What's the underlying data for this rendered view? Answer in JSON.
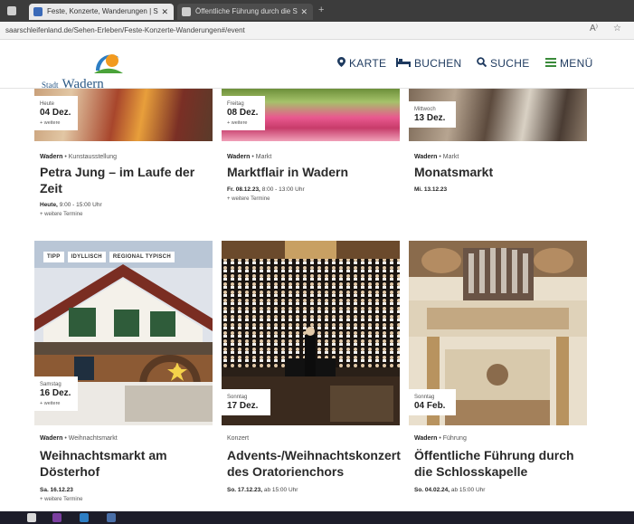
{
  "browser": {
    "tabs": [
      {
        "label": "Feste, Konzerte, Wanderungen | S",
        "active": true
      },
      {
        "label": "Öffentliche Führung durch die S",
        "active": false
      }
    ],
    "url": "saarschleifenland.de/Sehen-Erleben/Feste-Konzerte-Wanderungen#/event"
  },
  "header": {
    "logo_small": "Stadt",
    "logo_big": "Wadern",
    "nav": {
      "karte": "KARTE",
      "buchen": "BUCHEN",
      "suche": "SUCHE",
      "menu": "MENÜ"
    }
  },
  "events_row1": [
    {
      "weekday": "Heute",
      "day": "04 Dez.",
      "more": "+ weitere",
      "place": "Wadern",
      "category": "Kunstausstellung",
      "title": "Petra Jung – im Laufe der Zeit",
      "meta_bold": "Heute,",
      "meta_rest": "9:00 - 15:00 Uhr",
      "more_dates": "+ weitere Termine"
    },
    {
      "weekday": "Freitag",
      "day": "08 Dez.",
      "more": "+ weitere",
      "place": "Wadern",
      "category": "Markt",
      "title": "Marktflair in Wadern",
      "meta_bold": "Fr. 08.12.23,",
      "meta_rest": "8:00 - 13:00 Uhr",
      "more_dates": "+ weitere Termine"
    },
    {
      "weekday": "Mittwoch",
      "day": "13 Dez.",
      "more": "",
      "place": "Wadern",
      "category": "Markt",
      "title": "Monatsmarkt",
      "meta_bold": "Mi. 13.12.23",
      "meta_rest": "",
      "more_dates": ""
    }
  ],
  "events_row2": [
    {
      "tags": [
        "TIPP",
        "IDYLLISCH",
        "REGIONAL TYPISCH"
      ],
      "weekday": "Samstag",
      "day": "16 Dez.",
      "more": "+ weitere",
      "place": "Wadern",
      "category": "Weihnachtsmarkt",
      "title": "Weihnachtsmarkt am Dösterhof",
      "meta_bold": "Sa. 16.12.23",
      "meta_rest": "",
      "more_dates": "+ weitere Termine"
    },
    {
      "weekday": "Sonntag",
      "day": "17 Dez.",
      "place": "",
      "category": "Konzert",
      "title": "Advents-/Weihnachtskonzert des Oratorienchors",
      "meta_bold": "So. 17.12.23,",
      "meta_rest": "ab 15:00 Uhr"
    },
    {
      "weekday": "Sonntag",
      "day": "04 Feb.",
      "place": "Wadern",
      "category": "Führung",
      "title": "Öffentliche Führung durch die Schlosskapelle",
      "meta_bold": "So. 04.02.24,",
      "meta_rest": "ab 15:00 Uhr"
    }
  ],
  "colors": {
    "nav": "#1e3a5f",
    "menu_icon": "#3a8a3a",
    "logo": "#2c5a86"
  }
}
